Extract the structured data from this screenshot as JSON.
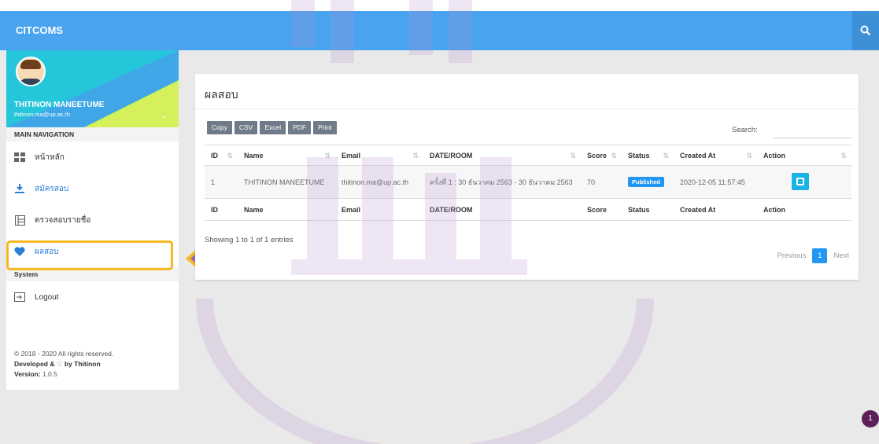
{
  "app": {
    "brand": "CITCOMS"
  },
  "profile": {
    "name": "THITINON MANEETUME",
    "email": "thitinon.ma@up.ac.th"
  },
  "sidebar": {
    "main_header": "MAIN NAVIGATION",
    "items": [
      {
        "label": "หน้าหลัก",
        "icon": "dashboard-icon"
      },
      {
        "label": "สมัครสอบ",
        "icon": "download-icon"
      },
      {
        "label": "ตรวจสอบรายชื่อ",
        "icon": "list-icon"
      },
      {
        "label": "ผลสอบ",
        "icon": "heart-icon"
      }
    ],
    "system_header": "System",
    "logout_label": "Logout"
  },
  "footer": {
    "copyright": "© 2018 - 2020 All rights reserved.",
    "developed_prefix": "Developed &",
    "developed_by": "by Thitinon",
    "version_label": "Version:",
    "version": "1.0.5"
  },
  "card": {
    "title": "ผลสอบ",
    "buttons": [
      "Copy",
      "CSV",
      "Excel",
      "PDF",
      "Print"
    ],
    "search_label": "Search:"
  },
  "table": {
    "columns": [
      "ID",
      "Name",
      "Email",
      "DATE/ROOM",
      "Score",
      "Status",
      "Created At",
      "Action"
    ],
    "rows": [
      {
        "id": "1",
        "name": "THITINON MANEETUME",
        "email": "thitinon.ma@up.ac.th",
        "date_room": "ครั้งที่ 1 : 30 ธันวาคม 2563 - 30 ธันวาคม 2563",
        "score": "70",
        "status": "Published",
        "created_at": "2020-12-05 11:57:45"
      }
    ],
    "info": "Showing 1 to 1 of 1 entries"
  },
  "pagination": {
    "previous": "Previous",
    "current": "1",
    "next": "Next"
  },
  "notification": {
    "count": "1"
  },
  "colors": {
    "topbar": "#4aa3ee",
    "accent": "#2196f3",
    "highlight": "#f6b820",
    "arrow": "#8e6bb8"
  }
}
